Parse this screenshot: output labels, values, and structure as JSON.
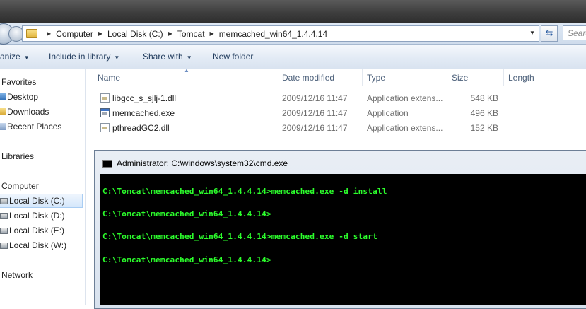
{
  "address": {
    "crumbs": [
      "Computer",
      "Local Disk (C:)",
      "Tomcat",
      "memcached_win64_1.4.4.14"
    ],
    "search_placeholder": "Search"
  },
  "toolbar": {
    "organize": "anize",
    "include": "Include in library",
    "share": "Share with",
    "new_folder": "New folder"
  },
  "nav": {
    "favorites": "Favorites",
    "desktop": "Desktop",
    "downloads": "Downloads",
    "recent": "Recent Places",
    "libraries": "Libraries",
    "computer": "Computer",
    "drives": [
      "Local Disk (C:)",
      "Local Disk (D:)",
      "Local Disk (E:)",
      "Local Disk (W:)"
    ],
    "network": "Network"
  },
  "columns": [
    "Name",
    "Date modified",
    "Type",
    "Size",
    "Length"
  ],
  "files": [
    {
      "name": "libgcc_s_sjlj-1.dll",
      "date": "2009/12/16 11:47",
      "type": "Application extens...",
      "size": "548 KB",
      "icon": "dll-icon"
    },
    {
      "name": "memcached.exe",
      "date": "2009/12/16 11:47",
      "type": "Application",
      "size": "496 KB",
      "icon": "exe-icon"
    },
    {
      "name": "pthreadGC2.dll",
      "date": "2009/12/16 11:47",
      "type": "Application extens...",
      "size": "152 KB",
      "icon": "dll-icon"
    }
  ],
  "cmd": {
    "title": "Administrator: C:\\windows\\system32\\cmd.exe",
    "lines": [
      "C:\\Tomcat\\memcached_win64_1.4.4.14>memcached.exe -d install",
      "C:\\Tomcat\\memcached_win64_1.4.4.14>",
      "C:\\Tomcat\\memcached_win64_1.4.4.14>memcached.exe -d start",
      "C:\\Tomcat\\memcached_win64_1.4.4.14>"
    ],
    "text_color": "#2cff2c"
  }
}
